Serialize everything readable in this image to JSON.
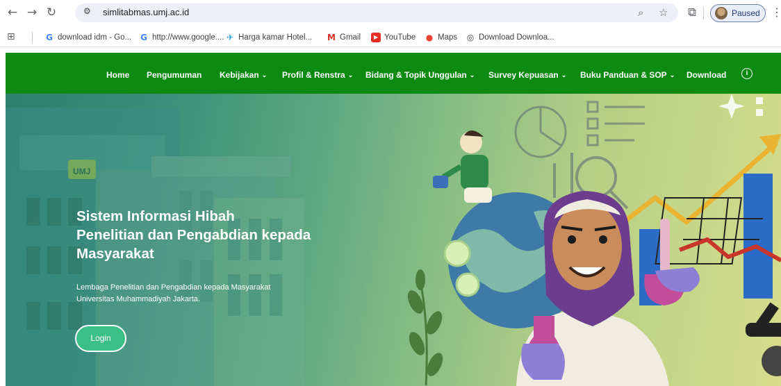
{
  "browser": {
    "url": "simlitabmas.umj.ac.id",
    "profile_label": "Paused",
    "icons": {
      "back": "back-arrow-icon",
      "forward": "forward-arrow-icon",
      "reload": "reload-icon",
      "site_info": "site-settings-icon",
      "zoom": "zoom-icon",
      "bookmark": "star-icon",
      "extensions": "puzzle-icon",
      "menu": "kebab-menu-icon"
    }
  },
  "bookmarks": [
    {
      "label": "download idm - Go...",
      "icon": "google-icon"
    },
    {
      "label": "http://www.google....",
      "icon": "google-icon"
    },
    {
      "label": "Harga kamar Hotel...",
      "icon": "traveloka-icon"
    },
    {
      "label": "Gmail",
      "icon": "gmail-icon"
    },
    {
      "label": "YouTube",
      "icon": "youtube-icon"
    },
    {
      "label": "Maps",
      "icon": "maps-icon"
    },
    {
      "label": "Download Downloa...",
      "icon": "globe-icon"
    }
  ],
  "nav": {
    "items": [
      "Home",
      "Pengumuman",
      "Kebijakan",
      "Profil & Renstra",
      "Bidang & Topik Unggulan",
      "Survey Kepuasan",
      "Buku Panduan & SOP",
      "Download"
    ],
    "dropdown_chevron": "⌄"
  },
  "hero": {
    "title_lines": [
      "Sistem Informasi Hibah",
      "Penelitian dan Pengabdian kepada",
      "Masyarakat"
    ],
    "subtitle_lines": [
      "Lembaga Penelitian dan Pengabdian kepada Masyarakat",
      "Universitas Muhammadiyah Jakarta."
    ],
    "login_label": "Login",
    "sign_text": "UMJ"
  },
  "colors": {
    "nav_green": "#0c8a12",
    "login_green": "#3cbf86",
    "hijab_purple": "#6b3d8c"
  }
}
